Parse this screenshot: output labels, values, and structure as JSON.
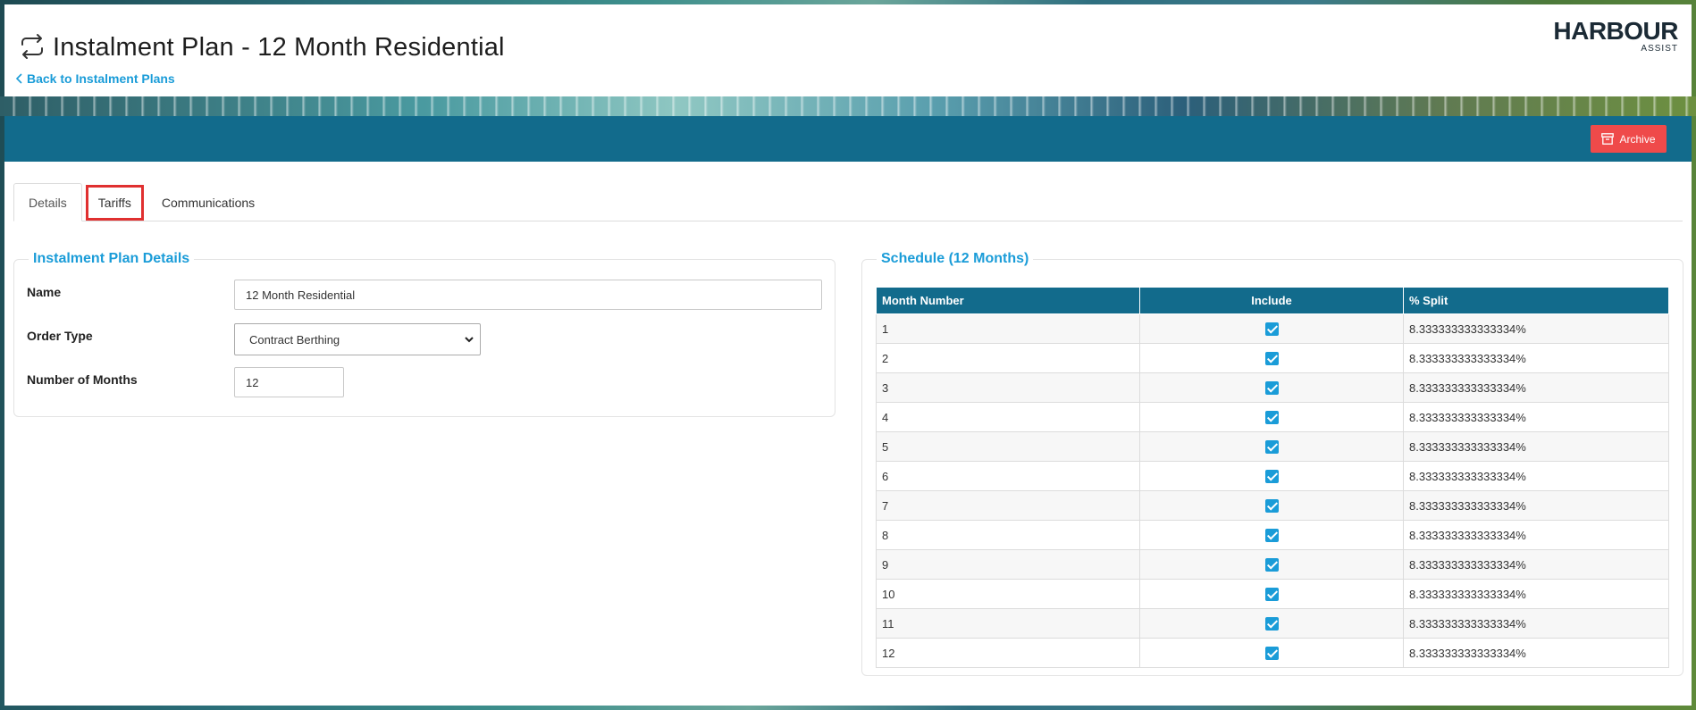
{
  "header": {
    "title": "Instalment Plan - 12 Month Residential",
    "back_link": "Back to Instalment Plans",
    "logo_main": "HARBOUR",
    "logo_sub": "ASSIST"
  },
  "toolbar": {
    "archive_label": "Archive",
    "archive_color": "#ef4a4a"
  },
  "tabs": [
    {
      "label": "Details",
      "active": true
    },
    {
      "label": "Tariffs",
      "active": false,
      "highlighted": true
    },
    {
      "label": "Communications",
      "active": false
    }
  ],
  "details": {
    "legend": "Instalment Plan Details",
    "name_label": "Name",
    "name_value": "12 Month Residential",
    "order_type_label": "Order Type",
    "order_type_value": "Contract Berthing",
    "months_label": "Number of Months",
    "months_value": "12"
  },
  "schedule": {
    "legend": "Schedule (12 Months)",
    "columns": [
      "Month Number",
      "Include",
      "% Split"
    ],
    "rows": [
      {
        "month": "1",
        "include": true,
        "split": "8.333333333333334%"
      },
      {
        "month": "2",
        "include": true,
        "split": "8.333333333333334%"
      },
      {
        "month": "3",
        "include": true,
        "split": "8.333333333333334%"
      },
      {
        "month": "4",
        "include": true,
        "split": "8.333333333333334%"
      },
      {
        "month": "5",
        "include": true,
        "split": "8.333333333333334%"
      },
      {
        "month": "6",
        "include": true,
        "split": "8.333333333333334%"
      },
      {
        "month": "7",
        "include": true,
        "split": "8.333333333333334%"
      },
      {
        "month": "8",
        "include": true,
        "split": "8.333333333333334%"
      },
      {
        "month": "9",
        "include": true,
        "split": "8.333333333333334%"
      },
      {
        "month": "10",
        "include": true,
        "split": "8.333333333333334%"
      },
      {
        "month": "11",
        "include": true,
        "split": "8.333333333333334%"
      },
      {
        "month": "12",
        "include": true,
        "split": "8.333333333333334%"
      }
    ]
  },
  "colors": {
    "accent": "#1a9cd8",
    "toolbar": "#126b8c"
  }
}
